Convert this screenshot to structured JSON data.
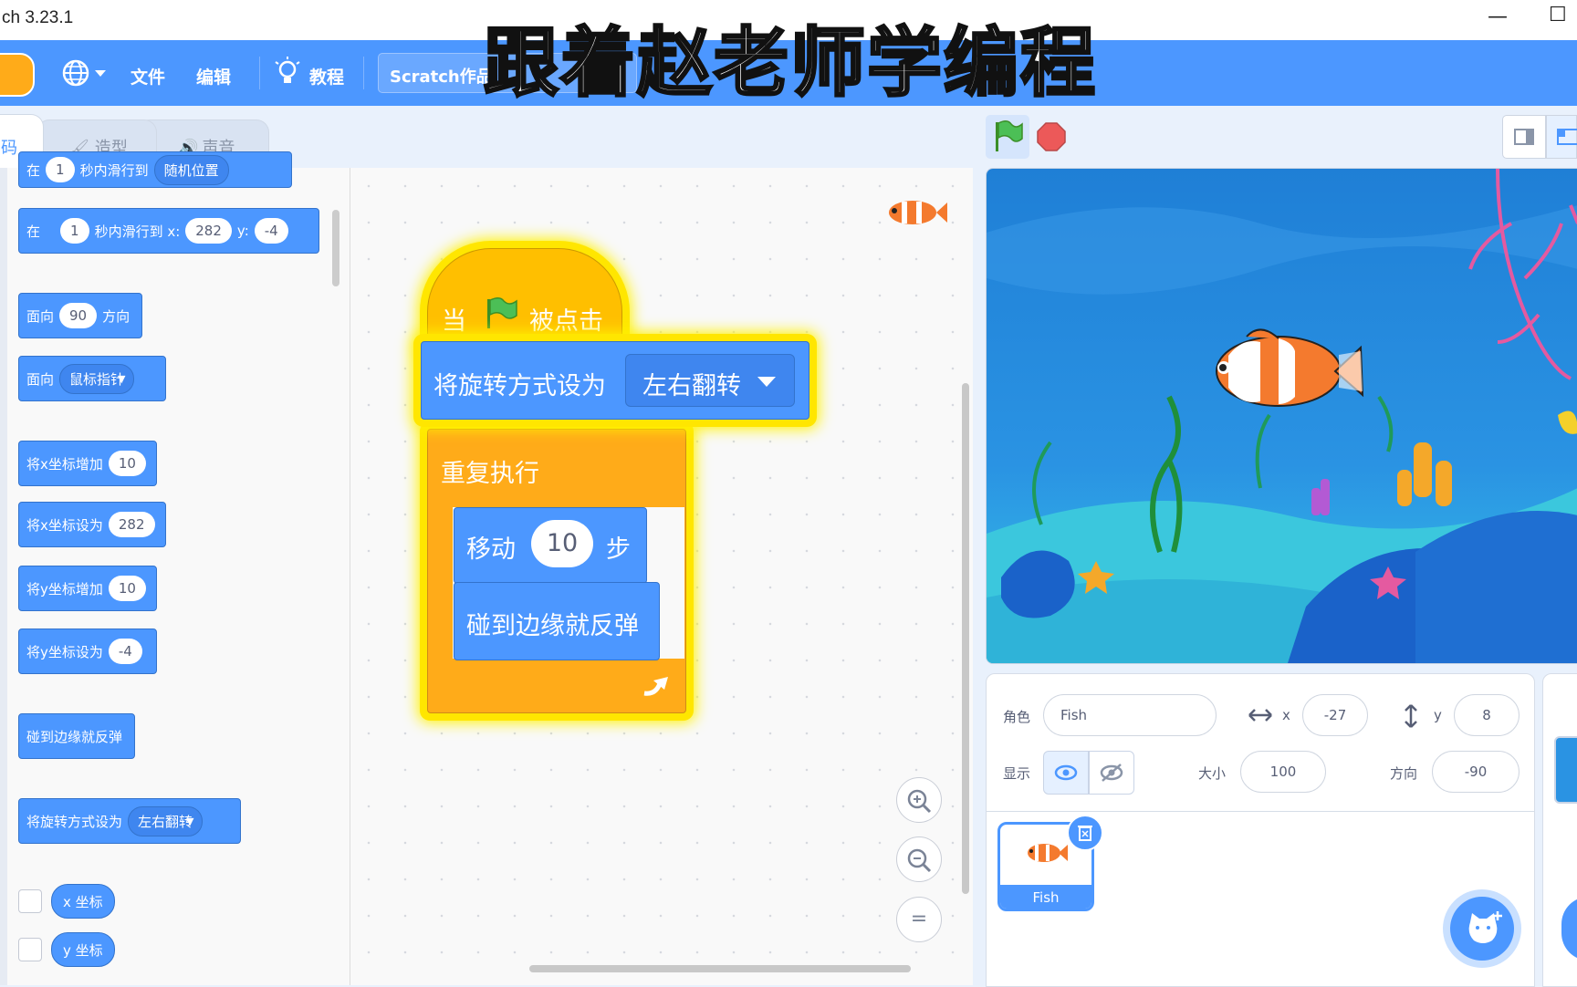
{
  "window": {
    "title": "ch 3.23.1"
  },
  "menu": {
    "file": "文件",
    "edit": "编辑",
    "tutorials": "教程",
    "project_title": "Scratch作品"
  },
  "overlay_caption": "跟着赵老师学编程",
  "tabs": {
    "code": "码",
    "costumes": "造型",
    "sounds": "声音"
  },
  "palette": {
    "glide_random": {
      "a": "在",
      "n": "1",
      "b": "秒内滑行到",
      "target": "随机位置"
    },
    "glide_xy": {
      "a": "在",
      "n": "1",
      "b": "秒内滑行到 x:",
      "x": "282",
      "ylab": "y:",
      "y": "-4"
    },
    "point_dir": {
      "a": "面向",
      "v": "90",
      "b": "方向"
    },
    "point_towards": {
      "a": "面向",
      "target": "鼠标指针"
    },
    "change_x": {
      "a": "将x坐标增加",
      "v": "10"
    },
    "set_x": {
      "a": "将x坐标设为",
      "v": "282"
    },
    "change_y": {
      "a": "将y坐标增加",
      "v": "10"
    },
    "set_y": {
      "a": "将y坐标设为",
      "v": "-4"
    },
    "bounce": {
      "a": "碰到边缘就反弹"
    },
    "rotation": {
      "a": "将旋转方式设为",
      "v": "左右翻转"
    },
    "x_pos": "x 坐标",
    "y_pos": "y 坐标"
  },
  "script": {
    "hat_when": "当",
    "hat_clicked": "被点击",
    "rotation_label": "将旋转方式设为",
    "rotation_value": "左右翻转",
    "forever": "重复执行",
    "move_a": "移动",
    "move_steps": "10",
    "move_b": "步",
    "bounce": "碰到边缘就反弹"
  },
  "zoom": {
    "in": "+",
    "out": "−",
    "reset": "="
  },
  "sprite_info": {
    "sprite_label": "角色",
    "sprite_name": "Fish",
    "x_label": "x",
    "x_value": "-27",
    "y_label": "y",
    "y_value": "8",
    "show_label": "显示",
    "size_label": "大小",
    "size_value": "100",
    "direction_label": "方向",
    "direction_value": "-90"
  },
  "sprites": [
    {
      "name": "Fish"
    }
  ],
  "colors": {
    "motion": "#4c97ff",
    "control": "#ffab19",
    "events": "#ffbf00",
    "menubar": "#4c97ff",
    "highlight": "#ffe600"
  }
}
